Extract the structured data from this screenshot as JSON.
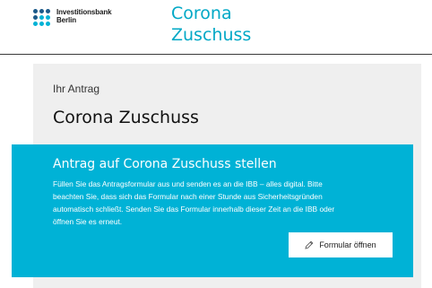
{
  "header": {
    "logo_line1": "Investitionsbank",
    "logo_line2": "Berlin",
    "title_line1": "Corona",
    "title_line2": "Zuschuss"
  },
  "main": {
    "eyebrow": "Ihr Antrag",
    "title": "Corona Zuschuss"
  },
  "card": {
    "title": "Antrag auf Corona Zuschuss stellen",
    "text": "Füllen Sie das Antragsformular aus und senden es an die IBB – alles digital. Bitte beachten Sie, dass sich das Formular nach einer Stunde aus Sicherheitsgründen automatisch schließt. Senden Sie das Formular innerhalb dieser Zeit an die IBB oder öffnen Sie es erneut.",
    "button_label": "Formular öffnen",
    "button_icon": "pencil-icon"
  },
  "colors": {
    "brand_cyan": "#00b2d6",
    "title_cyan": "#00a8c6",
    "logo_dark": "#1c5a8a",
    "panel_gray": "#efefef"
  }
}
